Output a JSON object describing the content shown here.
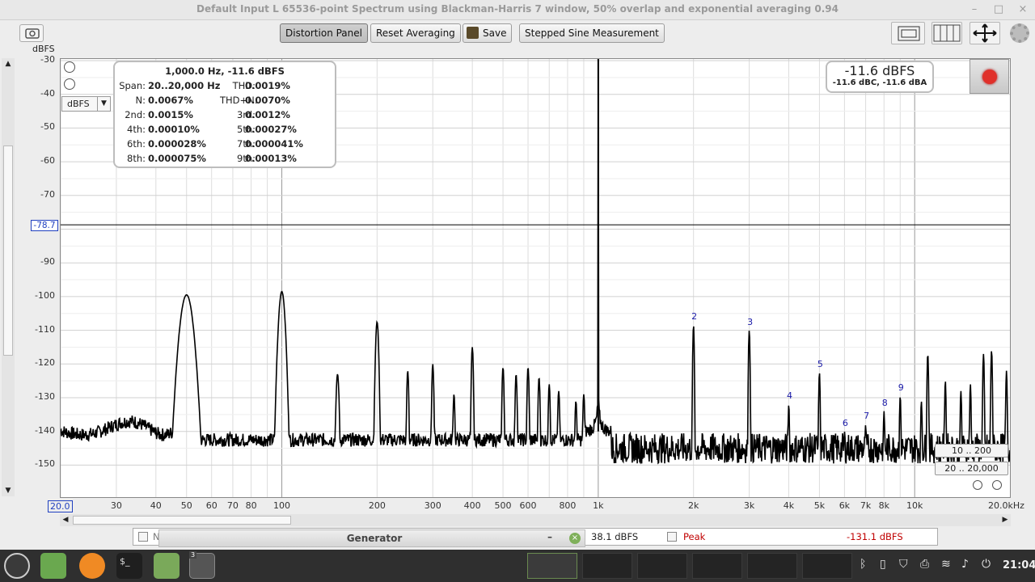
{
  "window": {
    "title": "Default Input L 65536-point Spectrum using Blackman-Harris 7 window, 50% overlap and exponential averaging 0.94",
    "controls": [
      "–",
      "×",
      "–",
      "×"
    ]
  },
  "toolbar": {
    "distortion_panel": "Distortion Panel",
    "reset_averaging": "Reset Averaging",
    "save": "Save",
    "stepped_sine": "Stepped Sine Measurement"
  },
  "y_axis": {
    "unit": "dBFS",
    "ticks": [
      "-30",
      "-40",
      "-50",
      "-60",
      "-70",
      "-80",
      "-90",
      "-100",
      "-110",
      "-120",
      "-130",
      "-140",
      "-150"
    ],
    "unit_select": "dBFS",
    "cursor_value": "-78.7"
  },
  "x_axis": {
    "ticks": [
      "20.0",
      "30",
      "40",
      "50",
      "60",
      "70",
      "80",
      "100",
      "200",
      "300",
      "400",
      "500",
      "600",
      "800",
      "1k",
      "2k",
      "3k",
      "4k",
      "5k",
      "6k",
      "7k",
      "8k",
      "10k",
      "20.0kHz"
    ]
  },
  "info_panel": {
    "header": "1,000.0 Hz, -11.6 dBFS",
    "rows": [
      {
        "l1": "Span:",
        "v1": "20..20,000 Hz",
        "l2": "THD:",
        "v2": "0.0019%"
      },
      {
        "l1": "N:",
        "v1": "0.0067%",
        "l2": "THD+N:",
        "v2": "0.0070%"
      },
      {
        "l1": "2nd:",
        "v1": "0.0015%",
        "l2": "3rd:",
        "v2": "0.0012%"
      },
      {
        "l1": "4th:",
        "v1": "0.00010%",
        "l2": "5th:",
        "v2": "0.00027%"
      },
      {
        "l1": "6th:",
        "v1": "0.000028%",
        "l2": "7th:",
        "v2": "0.000041%"
      },
      {
        "l1": "8th:",
        "v1": "0.000075%",
        "l2": "9th:",
        "v2": "0.00013%"
      }
    ]
  },
  "level_readout": {
    "main": "-11.6 dBFS",
    "sub": "-11.6 dBC, -11.6 dBA"
  },
  "harmonic_markers": [
    "2",
    "3",
    "4",
    "5",
    "6",
    "7",
    "8",
    "9"
  ],
  "zoom_presets": {
    "y_range": "10 .. 200",
    "x_range": "20 .. 20,000"
  },
  "legend": {
    "first_label": "N",
    "first_value": "38.1 dBFS",
    "peak_label": "Peak",
    "peak_value": "-131.1 dBFS"
  },
  "generator": {
    "title": "Generator",
    "minimize": "–"
  },
  "taskbar": {
    "badge": "3",
    "clock": "21:04"
  },
  "colors": {
    "trace": "#000000",
    "harmonic_label": "#1a1aa8",
    "peak_label": "#c00000",
    "record_button": "#e0302a",
    "taskbar": "#2f2f2f"
  }
}
